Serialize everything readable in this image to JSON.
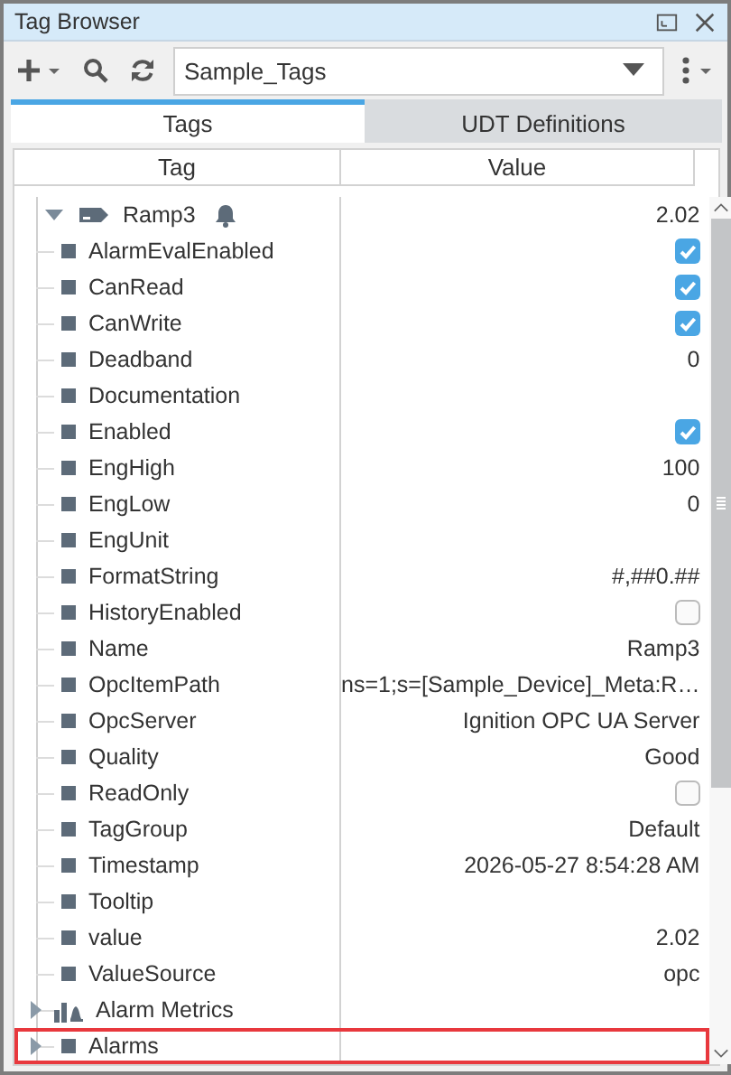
{
  "window": {
    "title": "Tag Browser"
  },
  "toolbar": {
    "provider": "Sample_Tags"
  },
  "tabs": [
    {
      "label": "Tags",
      "selected": true
    },
    {
      "label": "UDT Definitions",
      "selected": false
    }
  ],
  "table": {
    "columns": [
      "Tag",
      "Value"
    ],
    "tree": [
      {
        "label": "Ramp3",
        "kind": "tag",
        "alarm": true,
        "expanded": true,
        "value": {
          "kind": "text",
          "text": "2.02"
        },
        "children": [
          {
            "label": "AlarmEvalEnabled",
            "kind": "property",
            "value": {
              "kind": "checkbox",
              "checked": true
            }
          },
          {
            "label": "CanRead",
            "kind": "property",
            "value": {
              "kind": "checkbox",
              "checked": true
            }
          },
          {
            "label": "CanWrite",
            "kind": "property",
            "value": {
              "kind": "checkbox",
              "checked": true
            }
          },
          {
            "label": "Deadband",
            "kind": "property",
            "value": {
              "kind": "text",
              "text": "0"
            }
          },
          {
            "label": "Documentation",
            "kind": "property"
          },
          {
            "label": "Enabled",
            "kind": "property",
            "value": {
              "kind": "checkbox",
              "checked": true
            }
          },
          {
            "label": "EngHigh",
            "kind": "property",
            "value": {
              "kind": "text",
              "text": "100"
            }
          },
          {
            "label": "EngLow",
            "kind": "property",
            "value": {
              "kind": "text",
              "text": "0"
            }
          },
          {
            "label": "EngUnit",
            "kind": "property"
          },
          {
            "label": "FormatString",
            "kind": "property",
            "value": {
              "kind": "text",
              "text": "#,##0.##"
            }
          },
          {
            "label": "HistoryEnabled",
            "kind": "property",
            "value": {
              "kind": "checkbox",
              "checked": false
            }
          },
          {
            "label": "Name",
            "kind": "property",
            "value": {
              "kind": "text",
              "text": "Ramp3"
            }
          },
          {
            "label": "OpcItemPath",
            "kind": "property",
            "value": {
              "kind": "text",
              "text": "ns=1;s=[Sample_Device]_Meta:R…"
            }
          },
          {
            "label": "OpcServer",
            "kind": "property",
            "value": {
              "kind": "text",
              "text": "Ignition OPC UA Server"
            }
          },
          {
            "label": "Quality",
            "kind": "property",
            "value": {
              "kind": "text",
              "text": "Good"
            }
          },
          {
            "label": "ReadOnly",
            "kind": "property",
            "value": {
              "kind": "checkbox",
              "checked": false
            }
          },
          {
            "label": "TagGroup",
            "kind": "property",
            "value": {
              "kind": "text",
              "text": "Default"
            }
          },
          {
            "label": "Timestamp",
            "kind": "property",
            "value": {
              "kind": "text",
              "text": "2026-05-27 8:54:28 AM"
            }
          },
          {
            "label": "Tooltip",
            "kind": "property"
          },
          {
            "label": "value",
            "kind": "property",
            "value": {
              "kind": "text",
              "text": "2.02"
            }
          },
          {
            "label": "ValueSource",
            "kind": "property",
            "value": {
              "kind": "text",
              "text": "opc"
            }
          },
          {
            "label": "Alarm Metrics",
            "kind": "metrics",
            "expanded": false
          },
          {
            "label": "Alarms",
            "kind": "property",
            "expanded": false,
            "highlighted": true
          }
        ]
      }
    ]
  }
}
